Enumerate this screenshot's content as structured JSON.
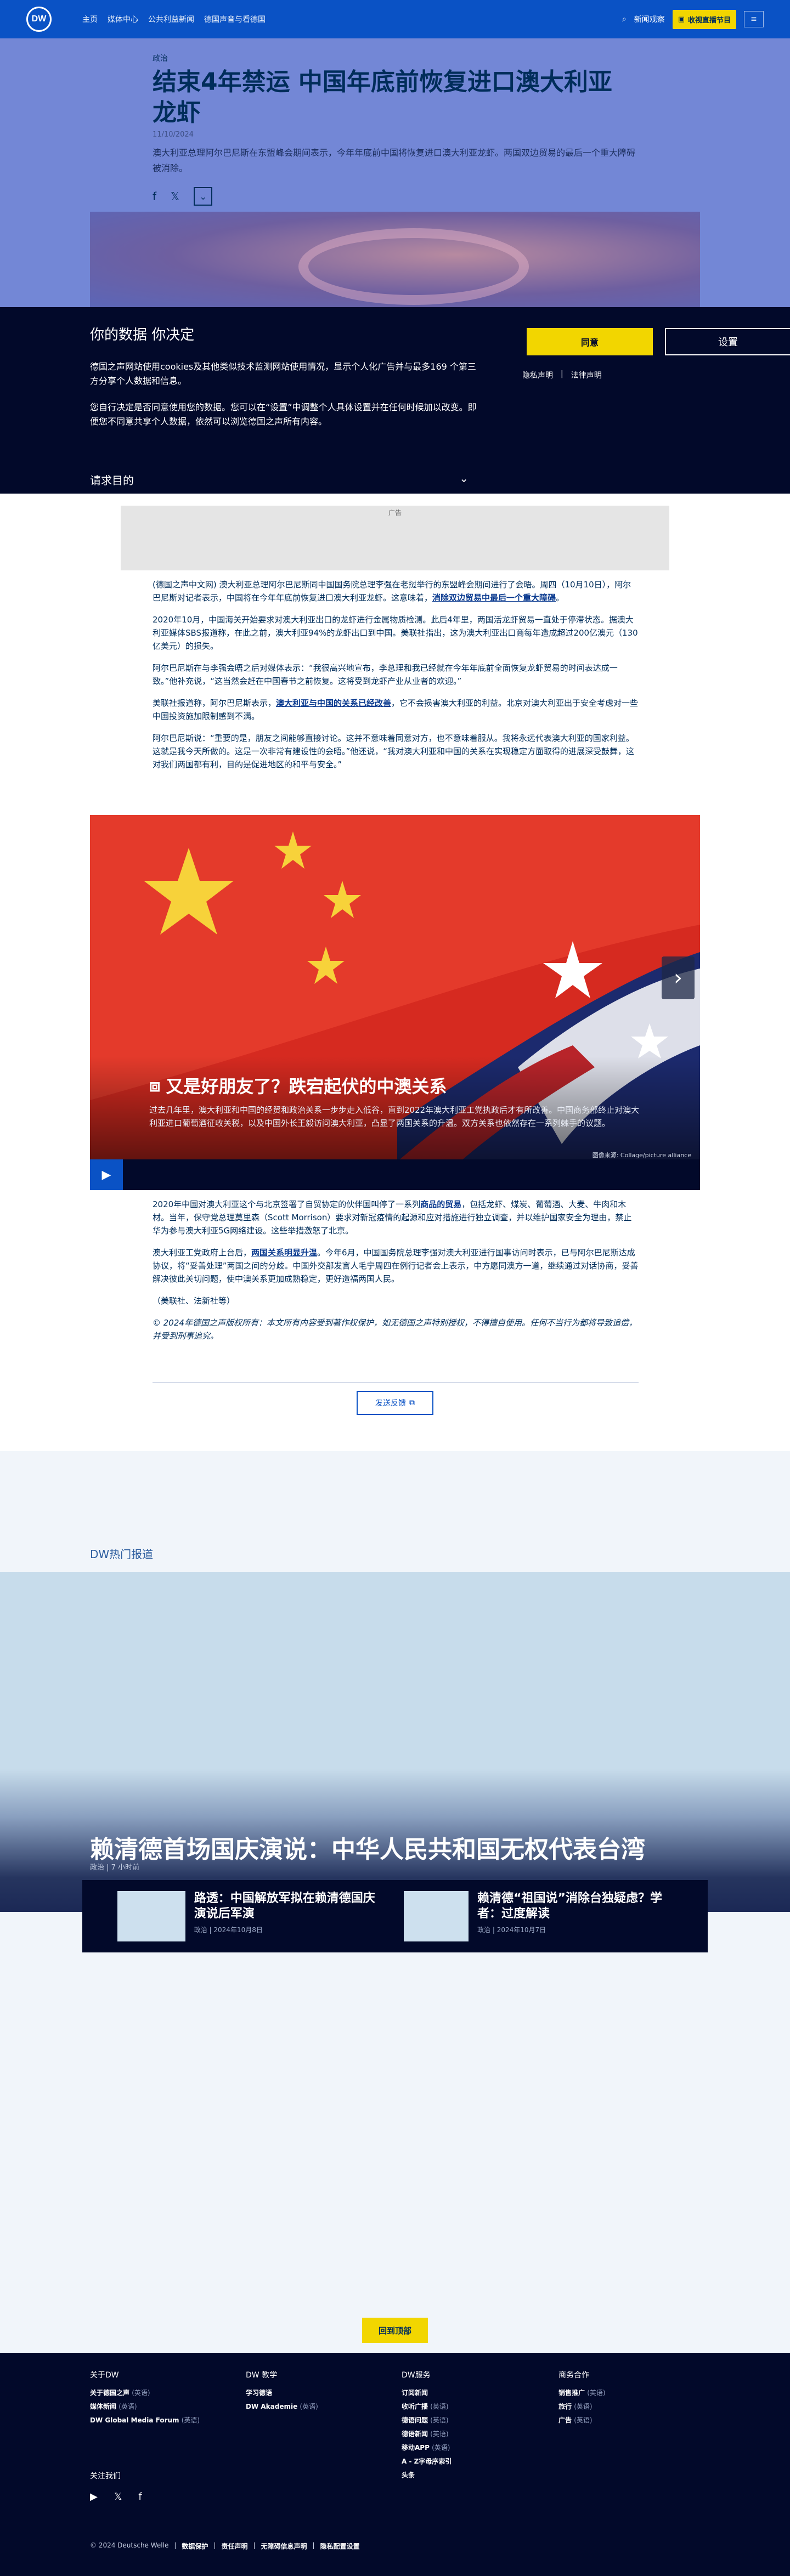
{
  "header": {
    "logo_text": "DW",
    "nav": [
      "主页",
      "媒体中心",
      "公共利益新闻",
      "德国声音与看德国"
    ],
    "login": "新闻观察",
    "live_label": "收视直播节目",
    "menu_label": "≡",
    "search_label": "⌕"
  },
  "hero": {
    "kicker": "政治",
    "title": "结束4年禁运 中国年底前恢复进口澳大利亚龙虾",
    "date": "11/10/2024",
    "lead": "澳大利亚总理阿尔巴尼斯在东盟峰会期间表示，今年年底前中国将恢复进口澳大利亚龙虾。两国双边贸易的最后一个重大障碍被消除。"
  },
  "consent": {
    "title": "你的数据 你决定",
    "p1": "德国之声网站使用cookies及其他类似技术监测网站使用情况，显示个人化广告并与最多169 个第三方分享个人数据和信息。",
    "p2": "您自行决定是否同意使用您的数据。您可以在“设置”中调整个人具体设置并在任何时候加以改变。即便您不同意共享个人数据，依然可以浏览德国之声所有内容。",
    "accept": "同意",
    "settings": "设置",
    "privacy": "隐私声明",
    "legal": "法律声明",
    "purposes": "请求目的"
  },
  "ad_label": "广告",
  "article": {
    "p1": "(德国之声中文网) 澳大利亚总理阿尔巴尼斯同中国国务院总理李强在老挝举行的东盟峰会期间进行了会晤。周四（10月10日），阿尔巴尼斯对记者表示，中国将在今年年底前恢复进口澳大利亚龙虾。这意味着，",
    "p1_link": "消除双边贸易中最后一个重大障碍",
    "p1_end": "。",
    "p2": "2020年10月，中国海关开始要求对澳大利亚出口的龙虾进行金属物质检测。此后4年里，两国活龙虾贸易一直处于停滞状态。据澳大利亚媒体SBS报道称，在此之前，澳大利亚94%的龙虾出口到中国。美联社指出，这为澳大利亚出口商每年造成超过200亿澳元（130亿美元）的损失。",
    "p3": "阿尔巴尼斯在与李强会晤之后对媒体表示：“我很高兴地宣布，李总理和我已经就在今年年底前全面恢复龙虾贸易的时间表达成一致。”他补充说，“这当然会赶在中国春节之前恢复。这将受到龙虾产业从业者的欢迎。”",
    "p4": "美联社报道称，阿尔巴尼斯表示，",
    "p4_link": "澳大利亚与中国的关系已经改善",
    "p4_end": "，它不会损害澳大利亚的利益。北京对澳大利亚出于安全考虑对一些中国投资施加限制感到不满。",
    "p5": "阿尔巴尼斯说：“重要的是，朋友之间能够直接讨论。这并不意味着同意对方，也不意味着服从。我将永远代表澳大利亚的国家利益。这就是我今天所做的。这是一次非常有建设性的会晤。”他还说，“我对澳大利亚和中国的关系在实现稳定方面取得的进展深受鼓舞，这对我们两国都有利，目的是促进地区的和平与安全。”",
    "p6": "2020年中国对澳大利亚这个与北京签署了自贸协定的伙伴国叫停了一系列",
    "p6_link": "商品的贸易",
    "p6_end": "，包括龙虾、煤炭、葡萄酒、大麦、牛肉和木材。当年，保守党总理莫里森（Scott Morrison）要求对新冠疫情的起源和应对措施进行独立调查，并以维护国家安全为理由，禁止华为参与澳大利亚5G网络建设。这些举措激怒了北京。",
    "p7": "澳大利亚工党政府上台后，",
    "p7_link": "两国关系明显升温",
    "p7_end": "。今年6月，中国国务院总理李强对澳大利亚进行国事访问时表示，已与阿尔巴尼斯达成协议，将“妥善处理”两国之间的分歧。中国外交部发言人毛宁周四在例行记者会上表示，中方愿同澳方一道，继续通过对话协商，妥善解决彼此关切问题，使中澳关系更加成熟稳定，更好造福两国人民。",
    "source": "（美联社、法新社等）",
    "copyright": "© 2024年德国之声版权所有：本文所有内容受到著作权保护，如无德国之声特别授权，不得擅自使用。任何不当行为都将导致追偿，并受到刑事追究。",
    "send_label": "发送反馈"
  },
  "gallery": {
    "title": "又是好朋友了？跌宕起伏的中澳关系",
    "text": "过去几年里，澳大利亚和中国的经贸和政治关系一步步走入低谷，直到2022年澳大利亚工党执政后才有所改善。中国商务部终止对澳大利亚进口葡萄酒征收关税，以及中国外长王毅访问澳大利亚，凸显了两国关系的升温。双方关系也依然存在一系列棘手的议题。",
    "credit": "图像来源: Collage/picture alliance",
    "play_icon": "▶",
    "next_icon": "›"
  },
  "trending": {
    "label": "DW热门报道",
    "title": "赖清德首场国庆演说：中华人民共和国无权代表台湾",
    "meta": "政治 | 7 小时前",
    "teasers": [
      {
        "title": "路透：中国解放军拟在赖清德国庆演说后军演",
        "meta": "政治 | 2024年10月8日"
      },
      {
        "title": "赖清德“祖国说”消除台独疑虑？学者：过度解读",
        "meta": "政治 | 2024年10月7日"
      }
    ],
    "back_to_top": "回到顶部"
  },
  "footer": {
    "col1": {
      "head": "关于DW",
      "items": [
        {
          "t": "关于德国之声",
          "s": "(英语)"
        },
        {
          "t": "媒体新闻",
          "s": "(英语)"
        },
        {
          "t": "DW Global Media Forum",
          "s": "(英语)"
        }
      ]
    },
    "col2": {
      "head": "DW 教学",
      "items": [
        {
          "t": "学习德语",
          "s": ""
        },
        {
          "t": "DW Akademie",
          "s": "(英语)"
        }
      ]
    },
    "col3": {
      "head": "DW服务",
      "items": [
        {
          "t": "订阅新闻",
          "s": ""
        },
        {
          "t": "收听广播",
          "s": "(英语)"
        },
        {
          "t": "德语问题",
          "s": "(英语)"
        },
        {
          "t": "德语新闻",
          "s": "(英语)"
        },
        {
          "t": "移动APP",
          "s": "(英语)"
        },
        {
          "t": "A - Z字母序索引",
          "s": ""
        },
        {
          "t": "头条",
          "s": ""
        }
      ]
    },
    "col4": {
      "head": "商务合作",
      "items": [
        {
          "t": "销售推广",
          "s": "(英语)"
        },
        {
          "t": "旅行",
          "s": "(英语)"
        },
        {
          "t": "广告",
          "s": "(英语)"
        }
      ]
    },
    "follow": "关注我们",
    "legal": [
      "© 2024 Deutsche Welle",
      "数据保护",
      "责任声明",
      "无障碍信息声明",
      "隐私配置设置"
    ]
  }
}
